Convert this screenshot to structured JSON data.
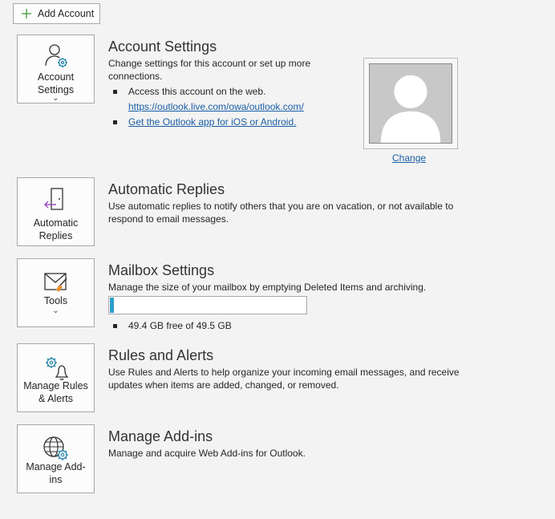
{
  "add_account": {
    "label": "Add Account",
    "icon": "plus-icon"
  },
  "account_settings": {
    "tile_label": "Account\nSettings",
    "tile_chevron": "⌄",
    "title": "Account Settings",
    "description": "Change settings for this account or set up more connections.",
    "bullet_web": "Access this account on the web.",
    "web_link": "https://outlook.live.com/owa/outlook.com/",
    "app_link": "Get the Outlook app for iOS or Android.",
    "change_label": "Change"
  },
  "automatic_replies": {
    "tile_label": "Automatic\nReplies",
    "title": "Automatic Replies",
    "description": "Use automatic replies to notify others that you are on vacation, or not available to respond to email messages."
  },
  "mailbox_settings": {
    "tile_label": "Tools",
    "tile_chevron": "⌄",
    "title": "Mailbox Settings",
    "description": "Manage the size of your mailbox by emptying Deleted Items and archiving.",
    "usage_fraction": 0.02,
    "free_text": "49.4 GB free of 49.5 GB"
  },
  "rules_alerts": {
    "tile_label": "Manage Rules\n& Alerts",
    "title": "Rules and Alerts",
    "description": "Use Rules and Alerts to help organize your incoming email messages, and receive updates when items are added, changed, or removed."
  },
  "addins": {
    "tile_label": "Manage Add-\nins",
    "title": "Manage Add-ins",
    "description": "Manage and acquire Web Add-ins for Outlook."
  },
  "colors": {
    "accent": "#1a5ea6",
    "progress": "#2aa0c8",
    "green": "#3a9a3a",
    "teal": "#1b7fa6",
    "purple": "#9b4fbd"
  }
}
